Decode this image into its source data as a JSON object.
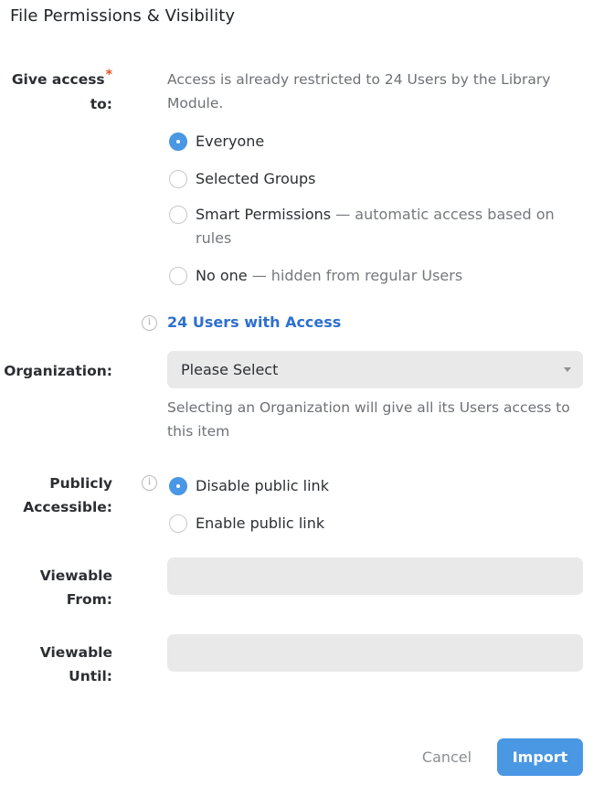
{
  "title": "File Permissions & Visibility",
  "give_access": {
    "label_line1": "Give access",
    "label_line2": "to:",
    "required_mark": "*",
    "help": "Access is already restricted to 24 Users by the Library Module.",
    "options": [
      {
        "label": "Everyone",
        "detail": "",
        "checked": true
      },
      {
        "label": "Selected Groups",
        "detail": "",
        "checked": false
      },
      {
        "label": "Smart Permissions",
        "detail": "— automatic access based on rules",
        "checked": false
      },
      {
        "label": "No one",
        "detail": "— hidden from regular Users",
        "checked": false
      }
    ],
    "users_link": "24 Users with Access"
  },
  "organization": {
    "label": "Organization:",
    "value": "Please Select",
    "help": "Selecting an Organization will give all its Users access to this item"
  },
  "publicly_accessible": {
    "label_line1": "Publicly",
    "label_line2": "Accessible:",
    "options": [
      {
        "label": "Disable public link",
        "checked": true
      },
      {
        "label": "Enable public link",
        "checked": false
      }
    ]
  },
  "viewable_from": {
    "label_line1": "Viewable",
    "label_line2": "From:",
    "value": ""
  },
  "viewable_until": {
    "label_line1": "Viewable",
    "label_line2": "Until:",
    "value": ""
  },
  "actions": {
    "cancel": "Cancel",
    "import": "Import"
  },
  "colors": {
    "accent": "#4a97e3",
    "link": "#2e6fd0",
    "required": "#e8541e",
    "field_bg": "#e9e9e9"
  }
}
